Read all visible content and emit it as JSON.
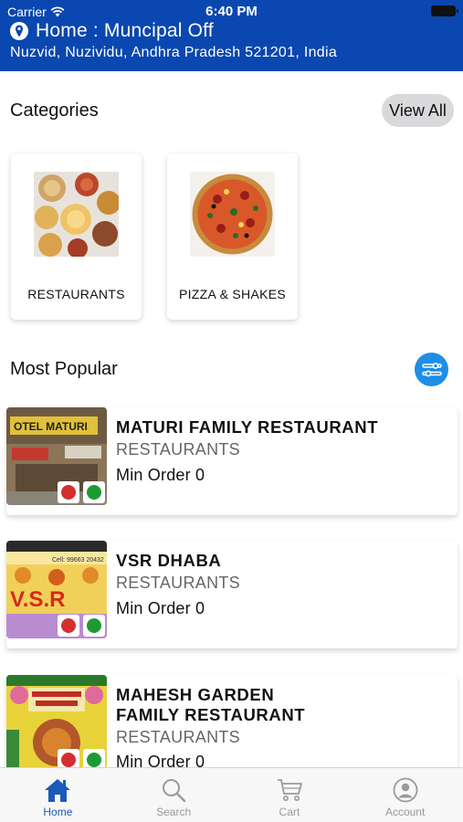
{
  "status_bar": {
    "carrier": "Carrier",
    "time": "6:40 PM"
  },
  "location": {
    "title": "Home : Muncipal Off",
    "address": "Nuzvid, Nuzividu, Andhra Pradesh 521201, India"
  },
  "categories": {
    "heading": "Categories",
    "view_all": "View All",
    "items": [
      {
        "label": "RESTAURANTS"
      },
      {
        "label": "PIZZA & SHAKES"
      }
    ]
  },
  "popular": {
    "heading": "Most Popular",
    "restaurants": [
      {
        "name": "MATURI FAMILY RESTAURANT",
        "category": "RESTAURANTS",
        "min_order": "Min Order 0"
      },
      {
        "name": "VSR DHABA",
        "category": "RESTAURANTS",
        "min_order": "Min Order 0"
      },
      {
        "name_line1": "MAHESH GARDEN",
        "name_line2": "FAMILY RESTAURANT",
        "category": "RESTAURANTS",
        "min_order": "Min Order 0"
      }
    ]
  },
  "tabs": [
    {
      "label": "Home",
      "icon": "home-icon"
    },
    {
      "label": "Search",
      "icon": "search-icon"
    },
    {
      "label": "Cart",
      "icon": "cart-icon"
    },
    {
      "label": "Account",
      "icon": "account-icon"
    }
  ],
  "colors": {
    "header_bg": "#0a47b0",
    "accent": "#1e8ee6",
    "active_tab": "#1a5ab8",
    "non_veg": "#d32f2f",
    "veg": "#1e9a35"
  }
}
